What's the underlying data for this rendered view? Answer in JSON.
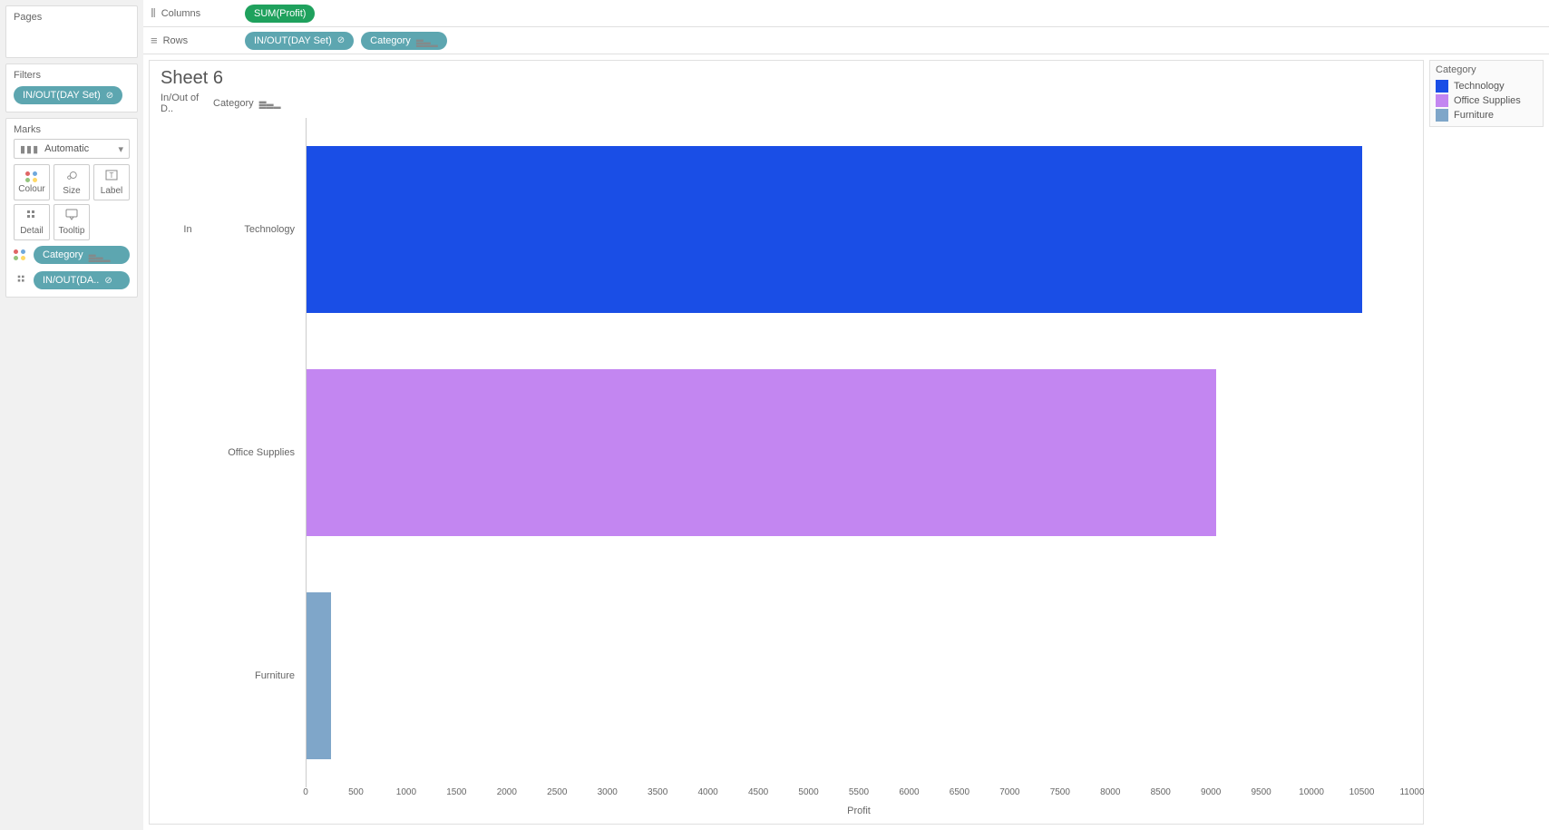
{
  "panels": {
    "pages_title": "Pages",
    "filters_title": "Filters",
    "filters_pill": "IN/OUT(DAY Set)",
    "marks_title": "Marks",
    "marks_type": "Automatic",
    "marks_cells": {
      "colour": "Colour",
      "size": "Size",
      "label": "Label",
      "detail": "Detail",
      "tooltip": "Tooltip"
    },
    "marks_pills": {
      "category": "Category",
      "inout": "IN/OUT(DA.."
    }
  },
  "shelves": {
    "columns_label": "Columns",
    "columns_pill": "SUM(Profit)",
    "rows_label": "Rows",
    "rows_pill1": "IN/OUT(DAY Set)",
    "rows_pill2": "Category"
  },
  "viz": {
    "title": "Sheet 6",
    "header_col1": "In/Out of D..",
    "header_col2": "Category",
    "row_group": "In",
    "xaxis_title": "Profit"
  },
  "legend": {
    "title": "Category",
    "items": [
      {
        "label": "Technology",
        "color": "#1a4ee6"
      },
      {
        "label": "Office Supplies",
        "color": "#c386f1"
      },
      {
        "label": "Furniture",
        "color": "#7fa6c9"
      }
    ]
  },
  "chart_data": {
    "type": "bar",
    "orientation": "horizontal",
    "categories": [
      "Technology",
      "Office Supplies",
      "Furniture"
    ],
    "values": [
      10500,
      9050,
      240
    ],
    "colors": [
      "#1a4ee6",
      "#c386f1",
      "#7fa6c9"
    ],
    "group": "In",
    "xlabel": "Profit",
    "xlim": [
      0,
      11000
    ],
    "xticks": [
      0,
      500,
      1000,
      1500,
      2000,
      2500,
      3000,
      3500,
      4000,
      4500,
      5000,
      5500,
      6000,
      6500,
      7000,
      7500,
      8000,
      8500,
      9000,
      9500,
      10000,
      10500,
      11000
    ]
  }
}
